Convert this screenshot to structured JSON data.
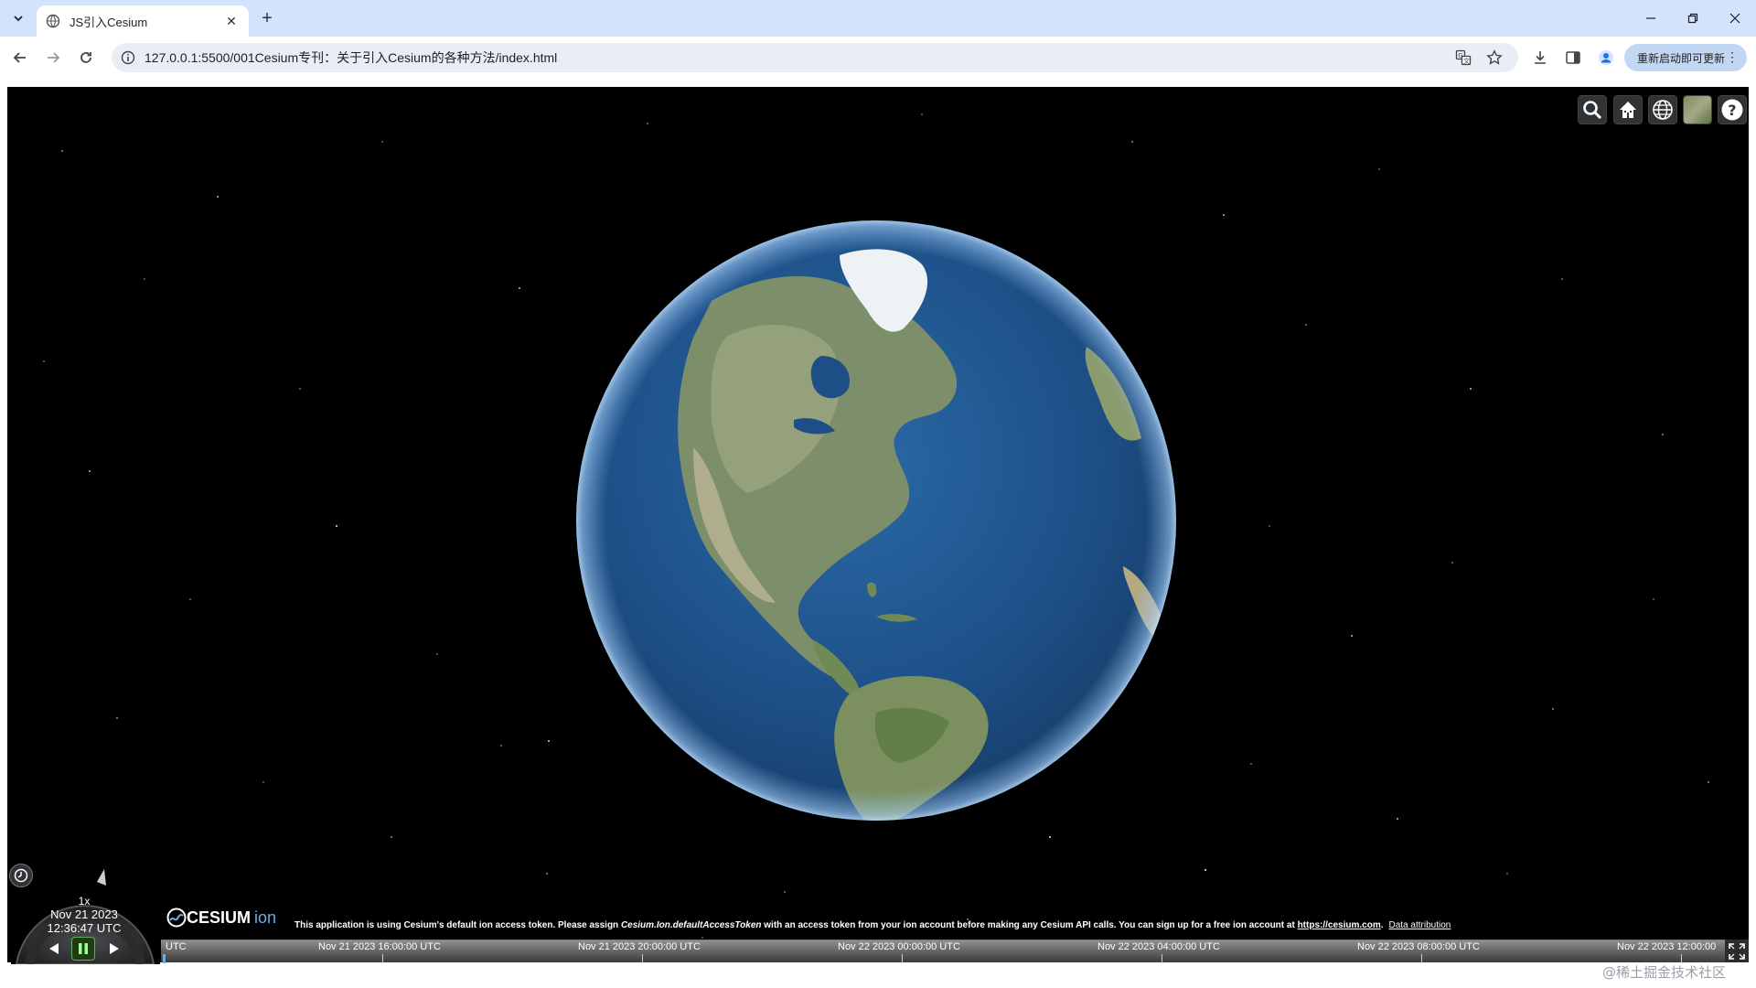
{
  "browser": {
    "tab_title": "JS引入Cesium",
    "tab_close": "✕",
    "new_tab": "+",
    "url": "127.0.0.1:5500/001Cesium专刊：关于引入Cesium的各种方法/index.html",
    "update_button": "重新启动即可更新",
    "update_menu": "⋮"
  },
  "cesium": {
    "toolbar": [
      {
        "name": "geocoder-search-icon",
        "tooltip": "search"
      },
      {
        "name": "home-icon",
        "tooltip": "home"
      },
      {
        "name": "scene-mode-globe-icon",
        "tooltip": "3D"
      },
      {
        "name": "base-layer-picker-icon",
        "tooltip": "imagery"
      },
      {
        "name": "help-icon",
        "tooltip": "help"
      }
    ],
    "animation": {
      "speed": "1x",
      "date": "Nov 21 2023",
      "time": "12:36:47 UTC"
    },
    "credit": {
      "logo_main": "CESIUM",
      "logo_ion": "ion",
      "text_1": "This application is using Cesium's default ion access token. Please assign ",
      "text_em": "Cesium.Ion.defaultAccessToken",
      "text_2": " with an access token from your ion account before making any Cesium API calls. You can sign up for a free ion account at ",
      "link": "https://cesium.com",
      "text_3": ".",
      "attribution": "Data attribution"
    },
    "timeline": {
      "labels": [
        "UTC",
        "Nov 21 2023 16:00:00 UTC",
        "Nov 21 2023 20:00:00 UTC",
        "Nov 22 2023 00:00:00 UTC",
        "Nov 22 2023 04:00:00 UTC",
        "Nov 22 2023 08:00:00 UTC",
        "Nov 22 2023 12:00:00"
      ]
    }
  },
  "watermark": "@稀土掘金技术社区",
  "colors": {
    "tab_strip": "#d3e3fd",
    "omnibox": "#e9eef6",
    "update_button": "#c2d7f4",
    "ocean": "#1d4f86",
    "space": "#000000"
  }
}
